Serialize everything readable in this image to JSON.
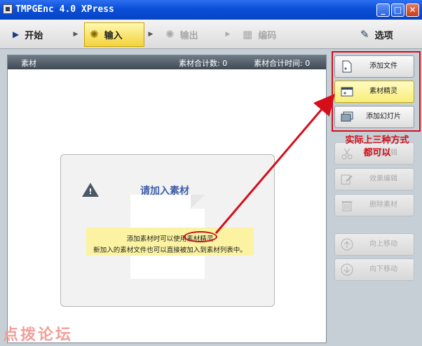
{
  "window": {
    "title": "TMPGEnc 4.0 XPress"
  },
  "toolbar": {
    "start_label": "开始",
    "input_label": "输入",
    "output_label": "输出",
    "encode_label": "编码",
    "options_label": "选项"
  },
  "panel": {
    "header_title": "素材",
    "total_count": "素材合计数: 0",
    "total_time": "素材合计时间: 0"
  },
  "info": {
    "title": "请加入素材",
    "line1": "添加素材时可以使用素材精灵",
    "line2": "新加入的素材文件也可以直接被加入到素材列表中。"
  },
  "side_buttons": [
    {
      "label": "添加文件",
      "enabled": true
    },
    {
      "label": "素材精灵",
      "enabled": true
    },
    {
      "label": "添加幻灯片",
      "enabled": true
    },
    {
      "label": "剪切编辑",
      "enabled": false
    },
    {
      "label": "效果编辑",
      "enabled": false
    },
    {
      "label": "删除素材",
      "enabled": false
    },
    {
      "label": "向上移动",
      "enabled": false
    },
    {
      "label": "向下移动",
      "enabled": false
    }
  ],
  "annotation": {
    "line1": "实际上三种方式",
    "line2": "都可以"
  },
  "watermark": "点拨论坛",
  "colors": {
    "accent_red": "#d40f1a",
    "titlebar_blue": "#0a4fd8",
    "wizard_yellow": "#f8ed7a"
  }
}
